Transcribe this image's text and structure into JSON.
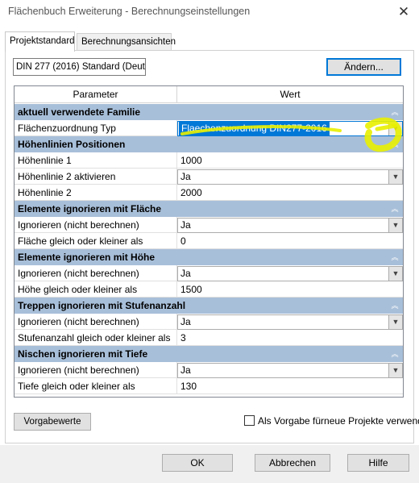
{
  "window": {
    "title": "Flächenbuch Erweiterung - Berechnungseinstellungen",
    "close_glyph": "✕"
  },
  "tabs": [
    {
      "label": "Projektstandard",
      "active": true
    },
    {
      "label": "Berechnungsansichten",
      "active": false
    }
  ],
  "standard": {
    "value": "DIN 277 (2016) Standard (Deutsc",
    "change_label": "Ändern..."
  },
  "grid": {
    "header": {
      "parameter": "Parameter",
      "value": "Wert"
    },
    "groups": [
      {
        "label": "aktuell verwendete Familie",
        "rows": [
          {
            "name": "Flächenzuordnung Typ",
            "value": "Flaechenzuordnung DIN277-2016",
            "kind": "combo"
          }
        ]
      },
      {
        "label": "Höhenlinien Positionen",
        "rows": [
          {
            "name": "Höhenlinie 1",
            "value": "1000",
            "kind": "text"
          },
          {
            "name": "Höhenlinie 2 aktivieren",
            "value": "Ja",
            "kind": "combo"
          },
          {
            "name": "Höhenlinie 2",
            "value": "2000",
            "kind": "text"
          }
        ]
      },
      {
        "label": "Elemente ignorieren mit Fläche",
        "rows": [
          {
            "name": "Ignorieren (nicht berechnen)",
            "value": "Ja",
            "kind": "combo"
          },
          {
            "name": "Fläche gleich oder kleiner als",
            "value": "0",
            "kind": "text"
          }
        ]
      },
      {
        "label": "Elemente ignorieren mit Höhe",
        "rows": [
          {
            "name": "Ignorieren (nicht berechnen)",
            "value": "Ja",
            "kind": "combo"
          },
          {
            "name": "Höhe gleich oder kleiner als",
            "value": "1500",
            "kind": "text"
          }
        ]
      },
      {
        "label": "Treppen ignorieren mit Stufenanzahl",
        "rows": [
          {
            "name": "Ignorieren (nicht berechnen)",
            "value": "Ja",
            "kind": "combo"
          },
          {
            "name": "Stufenanzahl gleich oder kleiner als",
            "value": "3",
            "kind": "text"
          }
        ]
      },
      {
        "label": "Nischen ignorieren mit Tiefe",
        "rows": [
          {
            "name": "Ignorieren (nicht berechnen)",
            "value": "Ja",
            "kind": "combo"
          },
          {
            "name": "Tiefe gleich oder kleiner als",
            "value": "130",
            "kind": "text"
          }
        ]
      }
    ]
  },
  "bottom": {
    "defaults_label": "Vorgabewerte",
    "checkbox_label": "Als Vorgabe fürneue Projekte verwend",
    "checkbox_checked": false
  },
  "footer": {
    "ok_label": "OK",
    "cancel_label": "Abbrechen",
    "help_label": "Hilfe"
  },
  "colors": {
    "group_header": "#a8bfd9",
    "selection": "#0078d7",
    "highlighter": "#e8f000"
  },
  "icons": {
    "collapse": "double-chevron-up-icon",
    "dropdown": "chevron-down-icon"
  }
}
